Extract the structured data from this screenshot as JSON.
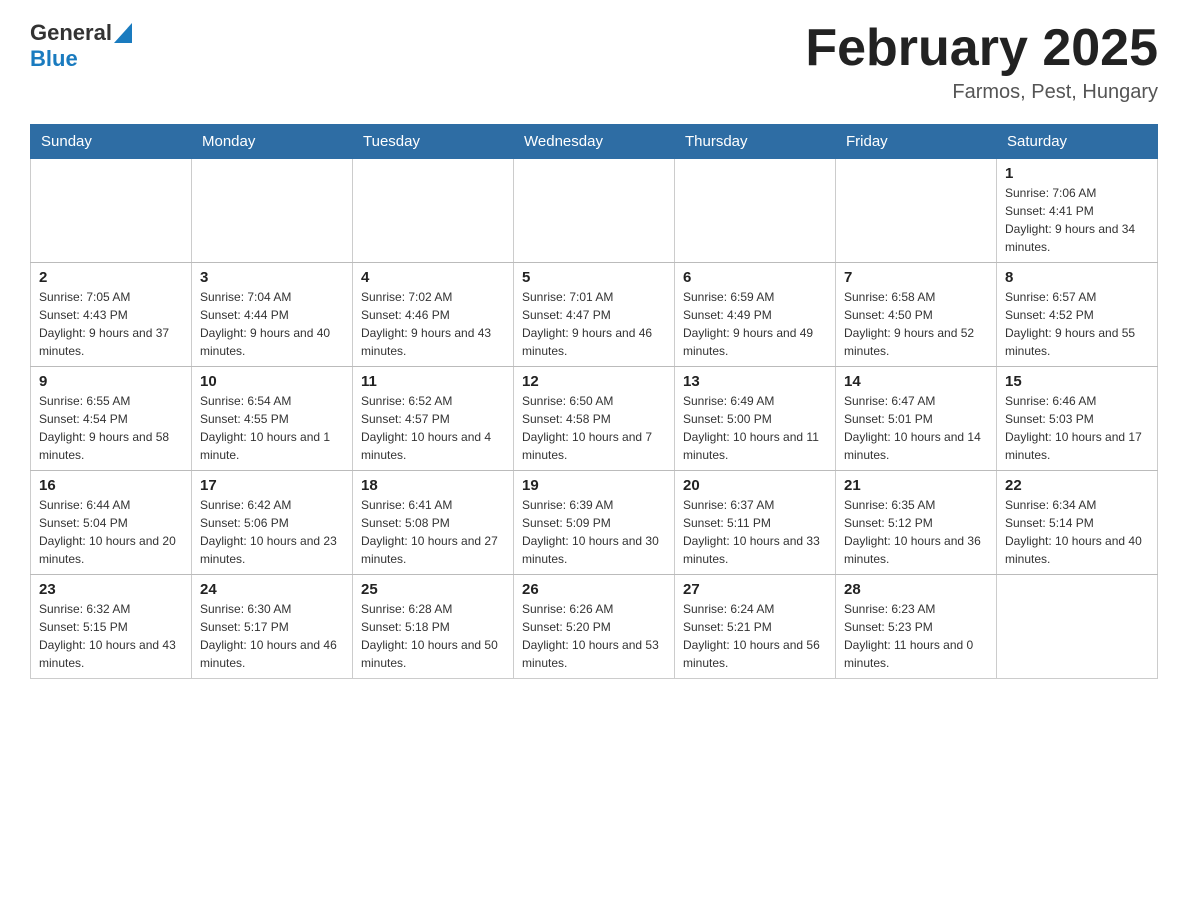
{
  "header": {
    "logo_general": "General",
    "logo_blue": "Blue",
    "month_title": "February 2025",
    "location": "Farmos, Pest, Hungary"
  },
  "days_of_week": [
    "Sunday",
    "Monday",
    "Tuesday",
    "Wednesday",
    "Thursday",
    "Friday",
    "Saturday"
  ],
  "weeks": [
    [
      {
        "day": "",
        "info": ""
      },
      {
        "day": "",
        "info": ""
      },
      {
        "day": "",
        "info": ""
      },
      {
        "day": "",
        "info": ""
      },
      {
        "day": "",
        "info": ""
      },
      {
        "day": "",
        "info": ""
      },
      {
        "day": "1",
        "info": "Sunrise: 7:06 AM\nSunset: 4:41 PM\nDaylight: 9 hours and 34 minutes."
      }
    ],
    [
      {
        "day": "2",
        "info": "Sunrise: 7:05 AM\nSunset: 4:43 PM\nDaylight: 9 hours and 37 minutes."
      },
      {
        "day": "3",
        "info": "Sunrise: 7:04 AM\nSunset: 4:44 PM\nDaylight: 9 hours and 40 minutes."
      },
      {
        "day": "4",
        "info": "Sunrise: 7:02 AM\nSunset: 4:46 PM\nDaylight: 9 hours and 43 minutes."
      },
      {
        "day": "5",
        "info": "Sunrise: 7:01 AM\nSunset: 4:47 PM\nDaylight: 9 hours and 46 minutes."
      },
      {
        "day": "6",
        "info": "Sunrise: 6:59 AM\nSunset: 4:49 PM\nDaylight: 9 hours and 49 minutes."
      },
      {
        "day": "7",
        "info": "Sunrise: 6:58 AM\nSunset: 4:50 PM\nDaylight: 9 hours and 52 minutes."
      },
      {
        "day": "8",
        "info": "Sunrise: 6:57 AM\nSunset: 4:52 PM\nDaylight: 9 hours and 55 minutes."
      }
    ],
    [
      {
        "day": "9",
        "info": "Sunrise: 6:55 AM\nSunset: 4:54 PM\nDaylight: 9 hours and 58 minutes."
      },
      {
        "day": "10",
        "info": "Sunrise: 6:54 AM\nSunset: 4:55 PM\nDaylight: 10 hours and 1 minute."
      },
      {
        "day": "11",
        "info": "Sunrise: 6:52 AM\nSunset: 4:57 PM\nDaylight: 10 hours and 4 minutes."
      },
      {
        "day": "12",
        "info": "Sunrise: 6:50 AM\nSunset: 4:58 PM\nDaylight: 10 hours and 7 minutes."
      },
      {
        "day": "13",
        "info": "Sunrise: 6:49 AM\nSunset: 5:00 PM\nDaylight: 10 hours and 11 minutes."
      },
      {
        "day": "14",
        "info": "Sunrise: 6:47 AM\nSunset: 5:01 PM\nDaylight: 10 hours and 14 minutes."
      },
      {
        "day": "15",
        "info": "Sunrise: 6:46 AM\nSunset: 5:03 PM\nDaylight: 10 hours and 17 minutes."
      }
    ],
    [
      {
        "day": "16",
        "info": "Sunrise: 6:44 AM\nSunset: 5:04 PM\nDaylight: 10 hours and 20 minutes."
      },
      {
        "day": "17",
        "info": "Sunrise: 6:42 AM\nSunset: 5:06 PM\nDaylight: 10 hours and 23 minutes."
      },
      {
        "day": "18",
        "info": "Sunrise: 6:41 AM\nSunset: 5:08 PM\nDaylight: 10 hours and 27 minutes."
      },
      {
        "day": "19",
        "info": "Sunrise: 6:39 AM\nSunset: 5:09 PM\nDaylight: 10 hours and 30 minutes."
      },
      {
        "day": "20",
        "info": "Sunrise: 6:37 AM\nSunset: 5:11 PM\nDaylight: 10 hours and 33 minutes."
      },
      {
        "day": "21",
        "info": "Sunrise: 6:35 AM\nSunset: 5:12 PM\nDaylight: 10 hours and 36 minutes."
      },
      {
        "day": "22",
        "info": "Sunrise: 6:34 AM\nSunset: 5:14 PM\nDaylight: 10 hours and 40 minutes."
      }
    ],
    [
      {
        "day": "23",
        "info": "Sunrise: 6:32 AM\nSunset: 5:15 PM\nDaylight: 10 hours and 43 minutes."
      },
      {
        "day": "24",
        "info": "Sunrise: 6:30 AM\nSunset: 5:17 PM\nDaylight: 10 hours and 46 minutes."
      },
      {
        "day": "25",
        "info": "Sunrise: 6:28 AM\nSunset: 5:18 PM\nDaylight: 10 hours and 50 minutes."
      },
      {
        "day": "26",
        "info": "Sunrise: 6:26 AM\nSunset: 5:20 PM\nDaylight: 10 hours and 53 minutes."
      },
      {
        "day": "27",
        "info": "Sunrise: 6:24 AM\nSunset: 5:21 PM\nDaylight: 10 hours and 56 minutes."
      },
      {
        "day": "28",
        "info": "Sunrise: 6:23 AM\nSunset: 5:23 PM\nDaylight: 11 hours and 0 minutes."
      },
      {
        "day": "",
        "info": ""
      }
    ]
  ]
}
